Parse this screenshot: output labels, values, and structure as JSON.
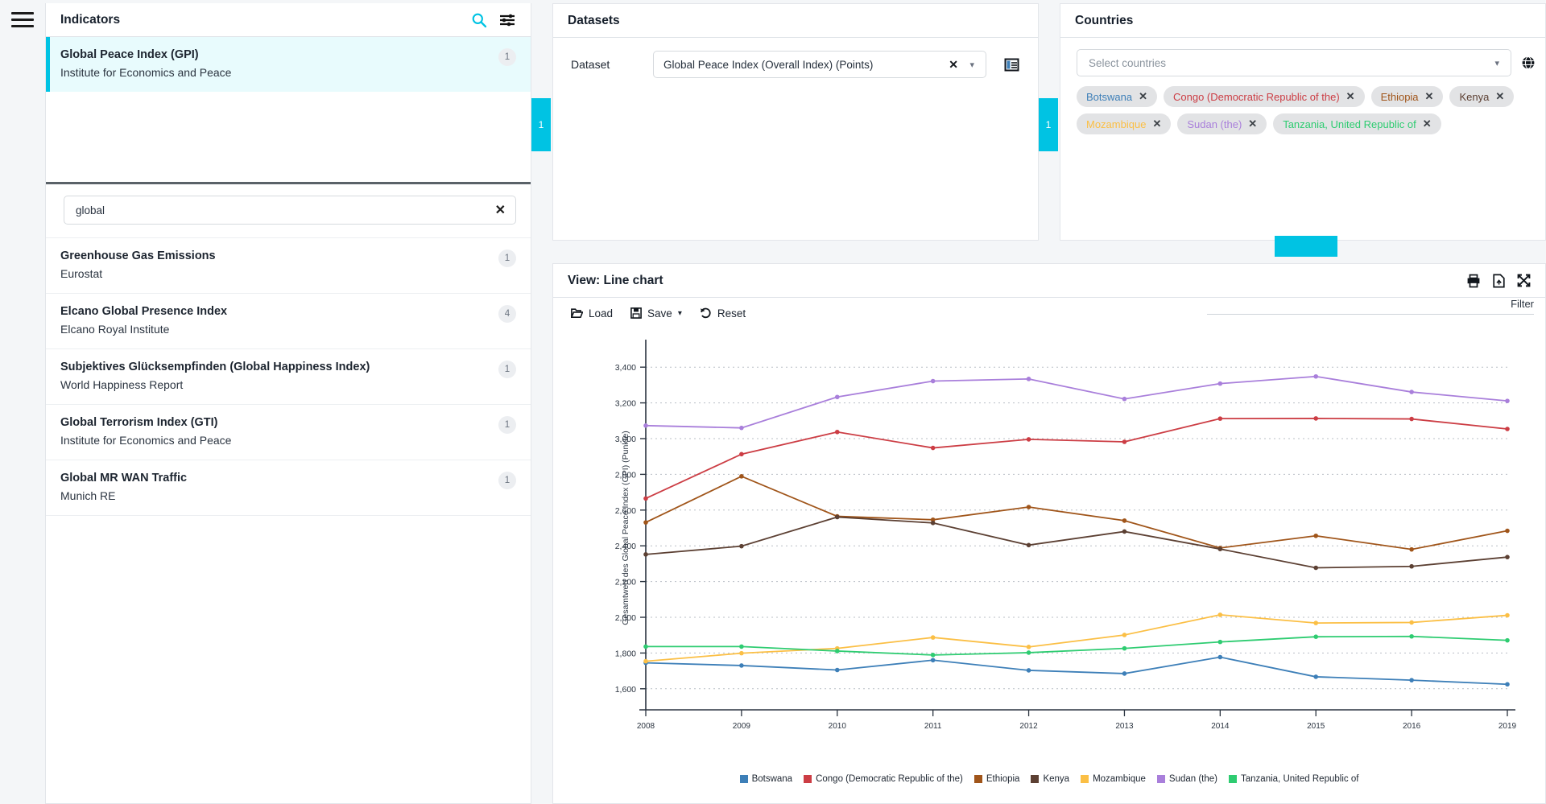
{
  "accent": "#00c3e3",
  "indicators": {
    "title": "Indicators",
    "search_icon": "search-icon",
    "filter_icon": "sliders-filter-icon",
    "selected": {
      "name": "Global Peace Index (GPI)",
      "source": "Institute for Economics and Peace",
      "badge": "1"
    },
    "search": {
      "value": "global",
      "placeholder": "",
      "clear_label": "✕"
    },
    "items": [
      {
        "name": "Greenhouse Gas Emissions",
        "source": "Eurostat",
        "badge": "1"
      },
      {
        "name": "Elcano Global Presence Index",
        "source": "Elcano Royal Institute",
        "badge": "4"
      },
      {
        "name": "Subjektives Glücksempfinden (Global Happiness Index)",
        "source": "World Happiness Report",
        "badge": "1"
      },
      {
        "name": "Global Terrorism Index (GTI)",
        "source": "Institute for Economics and Peace",
        "badge": "1"
      },
      {
        "name": "Global MR WAN Traffic",
        "source": "Munich RE",
        "badge": "1"
      }
    ]
  },
  "collapse_tabs": {
    "left": "1",
    "right": "1",
    "bottom": ""
  },
  "datasets": {
    "title": "Datasets",
    "field_label": "Dataset",
    "value": "Global Peace Index (Overall Index) (Points)",
    "clear_label": "✕",
    "chevron": "▾",
    "grid_icon": "table-grid-icon"
  },
  "countries": {
    "title": "Countries",
    "placeholder": "Select countries",
    "chevron": "▾",
    "globe_icon": "globe-icon",
    "chips": [
      {
        "label": "Botswana",
        "color": "#3d7fb8"
      },
      {
        "label": "Congo (Democratic Republic of the)",
        "color": "#cc3d44"
      },
      {
        "label": "Ethiopia",
        "color": "#a0551a"
      },
      {
        "label": "Kenya",
        "color": "#5c4033"
      },
      {
        "label": "Mozambique",
        "color": "#fbbf45"
      },
      {
        "label": "Sudan (the)",
        "color": "#a97fdb"
      },
      {
        "label": "Tanzania, United Republic of",
        "color": "#2ecc71"
      }
    ]
  },
  "view": {
    "title": "View: Line chart",
    "toolbar": [
      {
        "label": "Load",
        "icon": "folder-open-icon"
      },
      {
        "label": "Save",
        "icon": "floppy-disk-icon",
        "chevron": "▾"
      },
      {
        "label": "Reset",
        "icon": "undo-arrow-icon"
      }
    ],
    "actions": [
      {
        "icon": "printer-icon"
      },
      {
        "icon": "export-file-icon"
      },
      {
        "icon": "fullscreen-expand-icon"
      }
    ],
    "filter_label": "Filter"
  },
  "chart_data": {
    "type": "line",
    "title": "",
    "xlabel": "",
    "ylabel": "Gesamtwert des Global Peace Index (GPI) (Punkte)",
    "x": [
      2008,
      2009,
      2010,
      2011,
      2012,
      2013,
      2014,
      2015,
      2016,
      2019
    ],
    "xtick_labels": [
      "2008",
      "2009",
      "2010",
      "2011",
      "2012",
      "2013",
      "2014",
      "2015",
      "2016",
      "2019"
    ],
    "ylim": [
      1500,
      3500
    ],
    "yticks": [
      1600,
      1800,
      2000,
      2200,
      2400,
      2600,
      2800,
      3000,
      3200,
      3400
    ],
    "ytick_labels": [
      "1,600",
      "1,800",
      "2,000",
      "2,200",
      "2,400",
      "2,600",
      "2,800",
      "3,000",
      "3,200",
      "3,400"
    ],
    "grid": true,
    "legend_position": "bottom",
    "series": [
      {
        "name": "Botswana",
        "color": "#3d7fb8",
        "values": [
          1745,
          1730,
          1705,
          1760,
          1703,
          1685,
          1777,
          1667,
          1648,
          1625
        ]
      },
      {
        "name": "Congo (Democratic Republic of the)",
        "color": "#cc3d44",
        "values": [
          2665,
          2913,
          3037,
          2948,
          2996,
          2982,
          3112,
          3113,
          3110,
          3054
        ]
      },
      {
        "name": "Ethiopia",
        "color": "#a0551a",
        "values": [
          2531,
          2789,
          2565,
          2546,
          2617,
          2541,
          2388,
          2456,
          2380,
          2484
        ]
      },
      {
        "name": "Kenya",
        "color": "#5c4033",
        "values": [
          2352,
          2398,
          2561,
          2528,
          2404,
          2480,
          2382,
          2277,
          2285,
          2337
        ]
      },
      {
        "name": "Mozambique",
        "color": "#fbbf45",
        "values": [
          1754,
          1799,
          1826,
          1887,
          1834,
          1901,
          2014,
          1968,
          1971,
          2011
        ]
      },
      {
        "name": "Sudan (the)",
        "color": "#a97fdb",
        "values": [
          3073,
          3060,
          3233,
          3322,
          3334,
          3222,
          3308,
          3348,
          3261,
          3211
        ]
      },
      {
        "name": "Tanzania, United Republic of",
        "color": "#2ecc71",
        "values": [
          1836,
          1836,
          1811,
          1789,
          1802,
          1826,
          1862,
          1891,
          1893,
          1871
        ]
      }
    ]
  }
}
